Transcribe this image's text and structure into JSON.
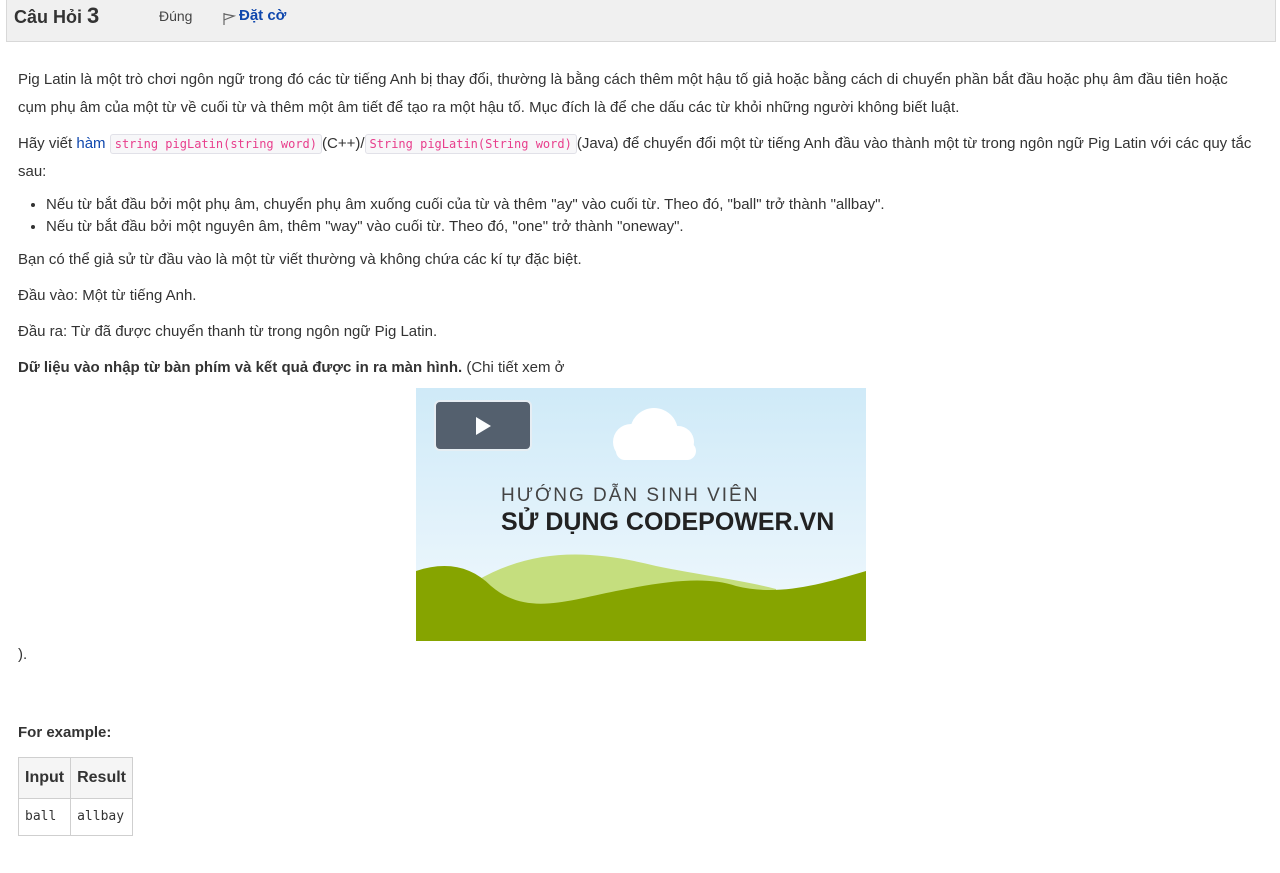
{
  "header": {
    "question_label": "Câu Hỏi",
    "question_number": "3",
    "state": "Đúng",
    "flag_label": "Đặt cờ"
  },
  "body": {
    "para1": "Pig Latin là một trò chơi ngôn ngữ trong đó các từ tiếng Anh bị thay đổi, thường là bằng cách thêm một hậu tố giả hoặc bằng cách di chuyển phần bắt đầu hoặc phụ âm đầu tiên hoặc cụm phụ âm của một từ về cuối từ và thêm một âm tiết để tạo ra một hậu tố. Mục đích là để che dấu các từ khỏi những người không biết luật.",
    "para2_prefix": "Hãy viết ",
    "para2_link": "hàm",
    "code_cpp": "string pigLatin(string word)",
    "para2_mid": "(C++)/",
    "code_java": "String pigLatin(String word)",
    "para2_suffix": "(Java) để chuyển đổi một từ tiếng Anh đầu vào thành một từ trong ngôn ngữ Pig Latin với các quy tắc sau:",
    "rules": [
      "Nếu từ bắt đầu bởi một phụ âm, chuyển phụ âm xuống cuối của từ và thêm \"ay\" vào cuối từ. Theo đó, \"ball\" trở thành \"allbay\".",
      "Nếu từ bắt đầu bởi một nguyên âm, thêm \"way\" vào cuối từ. Theo đó, \"one\" trở thành \"oneway\"."
    ],
    "assumption": "Bạn có thể giả sử từ đầu vào là một từ viết thường và không chứa các kí tự đặc biệt.",
    "input_desc": "Đầu vào: Một từ tiếng Anh.",
    "output_desc": "Đầu ra: Từ đã được chuyển thanh từ trong ngôn ngữ Pig Latin.",
    "io_bold": "Dữ liệu vào nhập từ bàn phím và kết quả được in ra màn hình.",
    "io_note": " (Chi tiết xem ở",
    "close_paren": ")."
  },
  "video": {
    "line1": "HƯỚNG DẪN SINH VIÊN",
    "line2": "SỬ DỤNG CODEPOWER.VN",
    "play_icon": "play-icon"
  },
  "example": {
    "heading": "For example:",
    "columns": [
      "Input",
      "Result"
    ],
    "rows": [
      [
        "ball",
        "allbay"
      ]
    ]
  },
  "colors": {
    "link": "#0f47ad",
    "code": "#e83e8c",
    "hill_dark": "#86a400",
    "hill_light": "#c5de7e"
  }
}
